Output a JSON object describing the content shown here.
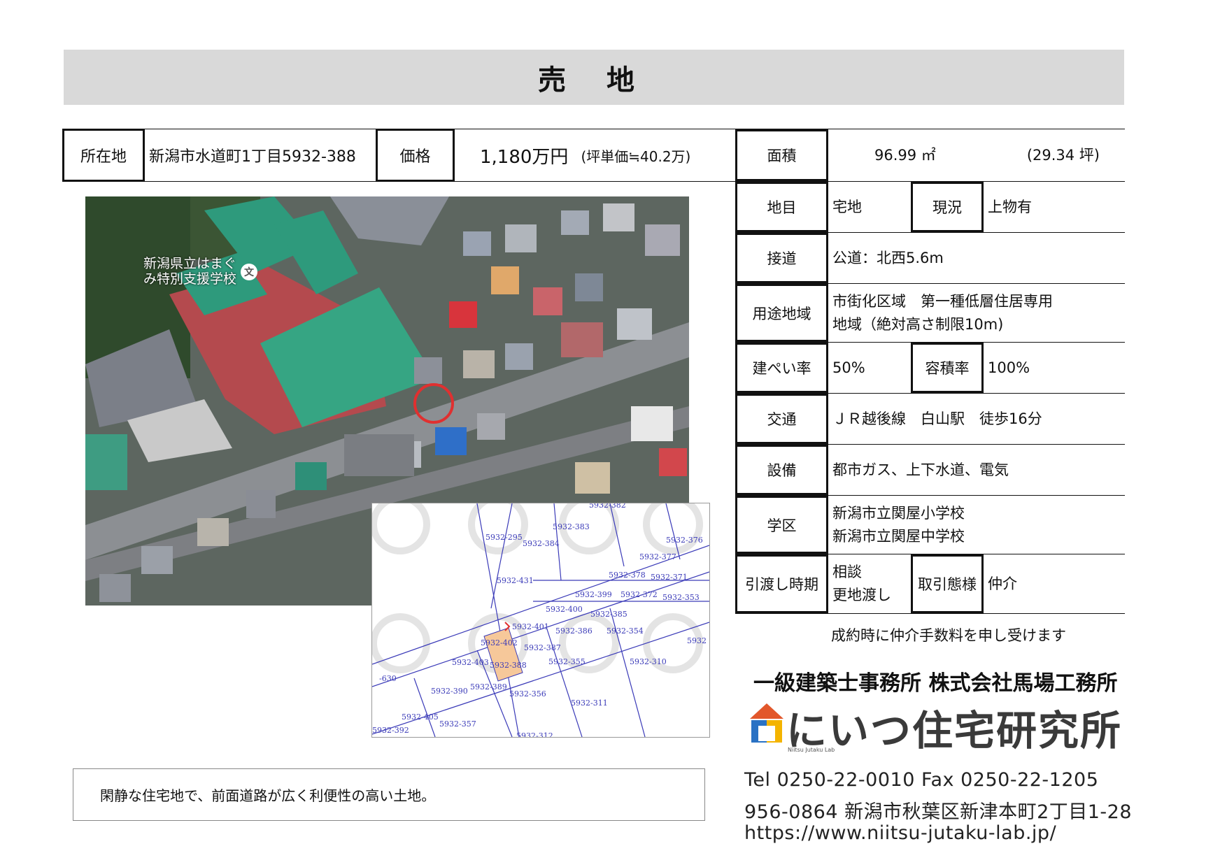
{
  "title": "売 地",
  "header_row": {
    "location_label": "所在地",
    "location_value": "新潟市水道町1丁目5932-388",
    "price_label": "価格",
    "price_value": "1,180万円",
    "price_per_tsubo": "(坪単価≒40.2万)"
  },
  "info": {
    "area_label": "面積",
    "area_sqm": "96.99 ㎡",
    "area_tsubo": "(29.34 坪)",
    "land_category_label": "地目",
    "land_category_value": "宅地",
    "current_status_label": "現況",
    "current_status_value": "上物有",
    "road_label": "接道",
    "road_value": "公道：北西5.6m",
    "zoning_label": "用途地域",
    "zoning_line1": "市街化区域　第一種低層住居専用",
    "zoning_line2": "地域（絶対高さ制限10m)",
    "coverage_label": "建ぺい率",
    "coverage_value": "50%",
    "far_label": "容積率",
    "far_value": "100%",
    "transport_label": "交通",
    "transport_value": "ＪＲ越後線　白山駅　徒歩16分",
    "facilities_label": "設備",
    "facilities_value": "都市ガス、上下水道、電気",
    "school_label": "学区",
    "school_line1": "新潟市立関屋小学校",
    "school_line2": "新潟市立関屋中学校",
    "handover_label": "引渡し時期",
    "handover_line1": "相談",
    "handover_line2": "更地渡し",
    "transaction_label": "取引態様",
    "transaction_value": "仲介"
  },
  "map": {
    "school_label_line1": "新潟県立はまぐ",
    "school_label_line2": "み特別支援学校",
    "school_icon": "文"
  },
  "plan": {
    "lots": [
      "5932-383",
      "5932-295",
      "5932-384",
      "5932-376",
      "5932-377",
      "5932-431",
      "5932-378",
      "5932-371",
      "5932-399",
      "5932-372",
      "5932-353",
      "5932-400",
      "5932-385",
      "5932-401",
      "5932-386",
      "5932-354",
      "5932-402",
      "5932-387",
      "5932-403",
      "5932-388",
      "5932-355",
      "5932-310",
      "5932-390",
      "5932-389",
      "5932-356",
      "5932-311",
      "5932-405",
      "5932-357",
      "5932-392",
      "5932-382",
      "5932-312",
      "5932",
      "-630"
    ]
  },
  "note": "閑静な住宅地で、前面道路が広く利便性の高い土地。",
  "fee_note": "成約時に仲介手数料を申し受けます",
  "company": {
    "name": "一級建築士事務所 株式会社馬場工務所",
    "brand": "にいつ住宅研究所",
    "brand_sub": "Niitsu Jutaku Lab",
    "tel_fax": "Tel 0250-22-0010  Fax 0250-22-1205",
    "address": "956-0864  新潟市秋葉区新津本町2丁目1-28",
    "url": "https://www.niitsu-jutaku-lab.jp/"
  },
  "colors": {
    "title_bg": "#d9d9d9",
    "plan_line": "#3a3ab8",
    "target_lot": "#f6c89a",
    "marker": "#e03030"
  }
}
